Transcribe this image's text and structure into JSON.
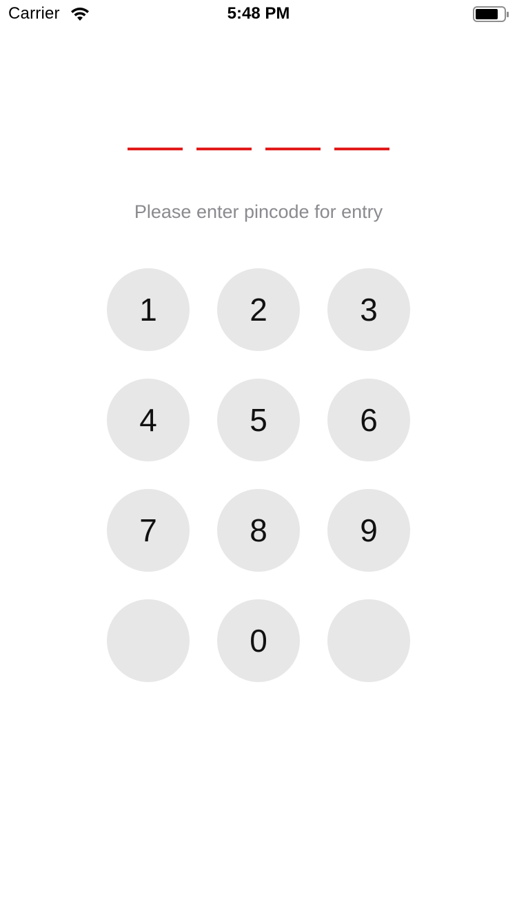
{
  "status_bar": {
    "carrier": "Carrier",
    "time": "5:48 PM",
    "wifi_icon": "wifi-icon",
    "battery_icon": "battery-icon"
  },
  "pin": {
    "length": 4,
    "slot_color": "#e21b1b"
  },
  "prompt": "Please enter pincode for entry",
  "keypad": {
    "key_color": "#e7e7e7",
    "keys": [
      "1",
      "2",
      "3",
      "4",
      "5",
      "6",
      "7",
      "8",
      "9",
      "",
      "0",
      ""
    ]
  }
}
